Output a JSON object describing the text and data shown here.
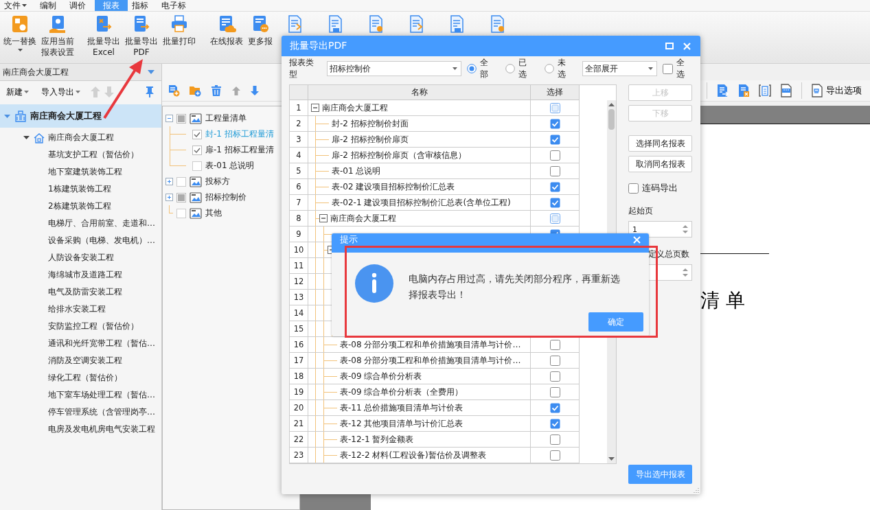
{
  "menu": [
    {
      "label": "文件",
      "dropdown": true,
      "selected": false
    },
    {
      "label": "编制",
      "dropdown": false,
      "selected": false
    },
    {
      "label": "调价",
      "dropdown": false,
      "selected": false
    },
    {
      "label": "报表",
      "dropdown": false,
      "selected": true
    },
    {
      "label": "指标",
      "dropdown": false,
      "selected": false
    },
    {
      "label": "电子标",
      "dropdown": false,
      "selected": false
    }
  ],
  "ribbon": [
    {
      "lines": [
        "统一替换"
      ],
      "dropdown": true
    },
    {
      "lines": [
        "应用当前",
        "报表设置"
      ],
      "dropdown": false
    },
    {
      "lines": [
        "批量导出",
        "Excel"
      ],
      "dropdown": false
    },
    {
      "lines": [
        "批量导出",
        "PDF"
      ],
      "dropdown": false
    },
    {
      "lines": [
        "批量打印"
      ],
      "dropdown": false
    },
    {
      "lines": [
        "在线报表"
      ],
      "dropdown": false
    },
    {
      "lines": [
        "更多报"
      ],
      "dropdown": false
    }
  ],
  "project_selector": {
    "value": "南庄商会大厦工程"
  },
  "left_toolbar": [
    {
      "label": "新建",
      "dropdown": true
    },
    {
      "label": "导入导出",
      "dropdown": true
    }
  ],
  "project_tree": [
    {
      "label": "南庄商会大厦工程",
      "selected": true,
      "expanded": true,
      "children": [
        {
          "label": "南庄商会大厦工程",
          "selected": false,
          "expanded": true,
          "children": [
            {
              "label": "基坑支护工程（暂估价）",
              "selected": false
            },
            {
              "label": "地下室建筑装饰工程",
              "selected": false
            },
            {
              "label": "1栋建筑装饰工程",
              "selected": false
            },
            {
              "label": "2栋建筑装饰工程",
              "selected": false
            },
            {
              "label": "电梯厅、合用前室、走道和…",
              "selected": false
            },
            {
              "label": "设备采购（电梯、发电机）…",
              "selected": false
            },
            {
              "label": "人防设备安装工程",
              "selected": false
            },
            {
              "label": "海绵城市及道路工程",
              "selected": false
            },
            {
              "label": "电气及防雷安装工程",
              "selected": false
            },
            {
              "label": "给排水安装工程",
              "selected": false
            },
            {
              "label": "安防监控工程（暂估价）",
              "selected": false
            },
            {
              "label": "通讯和光纤宽带工程（暂估…",
              "selected": false
            },
            {
              "label": "消防及空调安装工程",
              "selected": false
            },
            {
              "label": "绿化工程（暂估价）",
              "selected": false
            },
            {
              "label": "地下室车场处理工程（暂估…",
              "selected": false
            },
            {
              "label": "停车管理系统（含管理岗亭…",
              "selected": false
            },
            {
              "label": "电房及发电机房电气安装工程",
              "selected": false
            }
          ]
        }
      ]
    }
  ],
  "report_tree": [
    {
      "label": "工程量清单",
      "expanded": true,
      "checked": false,
      "partial": true,
      "selected": false,
      "children": [
        {
          "label": "封-1 招标工程量清",
          "checked": true,
          "partial": false,
          "selected": true
        },
        {
          "label": "扉-1 招标工程量清",
          "checked": true,
          "partial": false,
          "selected": false
        },
        {
          "label": "表-01 总说明",
          "checked": false,
          "partial": false,
          "selected": false
        }
      ]
    },
    {
      "label": "投标方",
      "expanded": false,
      "checked": false,
      "partial": false,
      "selected": false
    },
    {
      "label": "招标控制价",
      "expanded": false,
      "checked": false,
      "partial": true,
      "selected": false
    },
    {
      "label": "其他",
      "checked": false,
      "partial": false,
      "selected": false
    }
  ],
  "preview": {
    "toolbar_button": "导出选项",
    "page_heading": "清 单"
  },
  "export_dialog": {
    "title": "批量导出PDF",
    "report_type_label": "报表类型",
    "report_type": "招标控制价",
    "filters": [
      {
        "label": "全部",
        "selected": true
      },
      {
        "label": "已选",
        "selected": false
      },
      {
        "label": "未选",
        "selected": false
      }
    ],
    "expand_mode": "全部展开",
    "select_all": {
      "label": "全选",
      "checked": false
    },
    "columns": [
      "名称",
      "选择"
    ],
    "rows": [
      {
        "number": "1",
        "name": "南庄商会大厦工程",
        "expanded": true,
        "checked": false,
        "partial": true,
        "children": [
          {
            "number": "2",
            "name": "封-2 招标控制价封面",
            "checked": true,
            "partial": false
          },
          {
            "number": "3",
            "name": "扉-2 招标控制价扉页",
            "checked": true,
            "partial": false
          },
          {
            "number": "4",
            "name": "扉-2 招标控制价扉页（含审核信息）",
            "checked": false,
            "partial": false
          },
          {
            "number": "5",
            "name": "表-01 总说明",
            "checked": false,
            "partial": false
          },
          {
            "number": "6",
            "name": "表-02 建设项目招标控制价汇总表",
            "checked": true,
            "partial": false
          },
          {
            "number": "7",
            "name": "表-02-1 建设项目招标控制价汇总表(含单位工程)",
            "checked": true,
            "partial": false
          },
          {
            "number": "8",
            "name": "南庄商会大厦工程",
            "expanded": true,
            "checked": false,
            "partial": true,
            "children": [
              {
                "number": "9",
                "checked": true,
                "partial": false
              },
              {
                "number": "10",
                "expanded": true,
                "children": [
                  {
                    "number": "11"
                  },
                  {
                    "number": "12"
                  },
                  {
                    "number": "13"
                  },
                  {
                    "number": "14"
                  },
                  {
                    "number": "15"
                  }
                ]
              },
              {
                "number": "16",
                "name": "表-08 分部分项工程和单价措施项目清单与计价…",
                "checked": false,
                "partial": false
              },
              {
                "number": "17",
                "name": "表-08 分部分项工程和单价措施项目清单与计价…",
                "checked": false,
                "partial": false
              },
              {
                "number": "18",
                "name": "表-09 综合单价分析表",
                "checked": false,
                "partial": false
              },
              {
                "number": "19",
                "name": "表-09 综合单价分析表（全费用）",
                "checked": false,
                "partial": false
              },
              {
                "number": "20",
                "name": "表-11 总价措施项目清单与计价表",
                "checked": true,
                "partial": false
              },
              {
                "number": "21",
                "name": "表-12 其他项目清单与计价汇总表",
                "checked": true,
                "partial": false
              },
              {
                "number": "22",
                "name": "表-12-1 暂列金额表",
                "checked": false,
                "partial": false
              },
              {
                "number": "23",
                "name": "表-12-2 材料(工程设备)暂估价及调整表",
                "checked": false,
                "partial": false
              }
            ]
          }
        ]
      }
    ],
    "side_buttons": [
      {
        "label": "上移",
        "disabled": true
      },
      {
        "label": "下移",
        "disabled": true
      },
      {
        "label": "选择同名报表",
        "disabled": false
      },
      {
        "label": "取消同名报表",
        "disabled": false
      }
    ],
    "continuous": {
      "label": "连码导出",
      "checked": false
    },
    "start_page_label": "起始页",
    "start_page": "1",
    "total_pages_label": "定义总页数",
    "export_button": "导出选中报表"
  },
  "alert": {
    "title": "提示",
    "message": "电脑内存占用过高，请先关闭部分程序，再重新选择报表导出！",
    "ok_button": "确定"
  }
}
